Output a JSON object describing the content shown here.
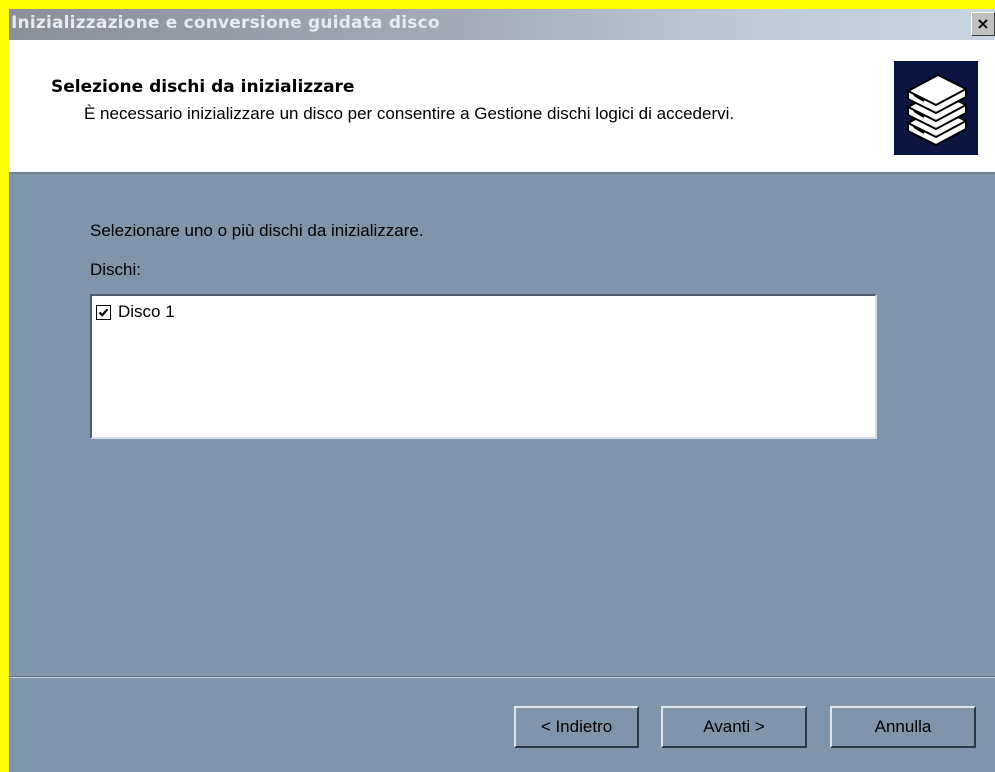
{
  "window": {
    "title": "Inizializzazione e conversione guidata disco",
    "close_glyph": "×",
    "close_icon": "close-icon"
  },
  "header": {
    "title": "Selezione dischi da inizializzare",
    "subtitle": "È necessario inizializzare un disco per consentire a Gestione dischi logici di accedervi.",
    "logo_icon": "stacked-disks-icon"
  },
  "content": {
    "instruction": "Selezionare uno o più dischi da inizializzare.",
    "list_label": "Dischi:",
    "disks": [
      {
        "label": "Disco 1",
        "checked": true
      }
    ]
  },
  "buttons": {
    "back": "< Indietro",
    "next": "Avanti >",
    "cancel": "Annulla"
  },
  "colors": {
    "dialog_background": "#7f95ab",
    "header_background": "#ffffff",
    "outer_border": "#ffff00",
    "logo_background": "#0a1540"
  }
}
